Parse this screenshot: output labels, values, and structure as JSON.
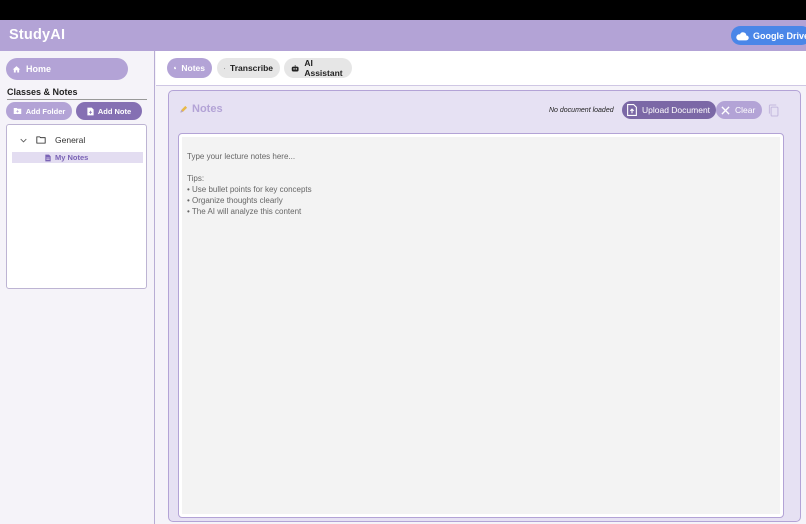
{
  "header": {
    "app_title": "StudyAI",
    "google_drive_label": "Google Drive"
  },
  "sidebar": {
    "home_label": "Home",
    "section_title": "Classes & Notes",
    "add_folder_label": "Add Folder",
    "add_note_label": "Add Note",
    "tree": {
      "folder_name": "General",
      "note_name": "My Notes"
    }
  },
  "tabs": [
    {
      "label": "Notes",
      "icon": "notes-icon",
      "active": true
    },
    {
      "label": "Transcribe",
      "icon": "microphone-icon",
      "active": false
    },
    {
      "label": "AI Assistant",
      "icon": "robot-icon",
      "active": false
    }
  ],
  "notes_panel": {
    "title": "Notes",
    "document_status": "No document loaded",
    "upload_label": "Upload Document",
    "clear_label": "Clear",
    "editor_value": "",
    "editor_placeholder": "Type your lecture notes here...\n\nTips:\n• Use bullet points for key concepts\n• Organize thoughts clearly\n• The AI will analyze this content"
  },
  "colors": {
    "accent": "#b3a3d6",
    "accent_dark": "#8570b3",
    "upload_button": "#7b68a6",
    "google_drive": "#4a86e8",
    "panel_bg": "#e6e1f3"
  }
}
